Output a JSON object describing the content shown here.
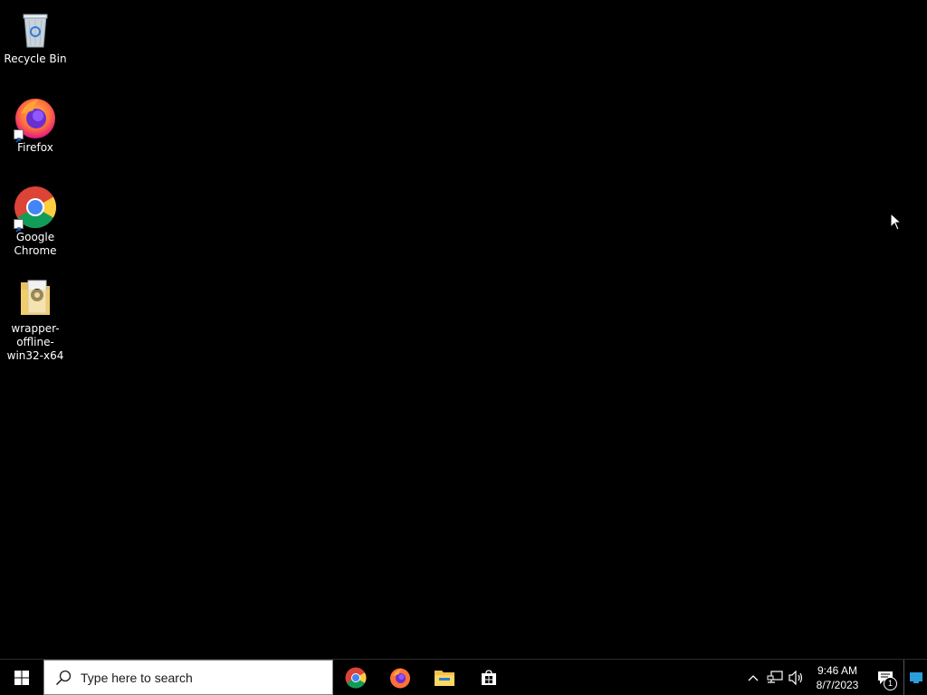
{
  "desktop": {
    "icons": [
      {
        "label": "Recycle Bin",
        "icon": "recycle-bin-icon"
      },
      {
        "label": "Firefox",
        "icon": "firefox-icon",
        "shortcut": true
      },
      {
        "label": "Google Chrome",
        "icon": "chrome-icon",
        "shortcut": true
      },
      {
        "label": "wrapper-offline-win32-x64",
        "icon": "folder-icon"
      }
    ],
    "background_color": "#000000"
  },
  "taskbar": {
    "start_icon": "windows-logo-icon",
    "search_placeholder": "Type here to search",
    "pinned": [
      {
        "name": "Google Chrome",
        "icon": "chrome-icon"
      },
      {
        "name": "Firefox",
        "icon": "firefox-icon"
      },
      {
        "name": "File Explorer",
        "icon": "file-explorer-icon"
      },
      {
        "name": "Microsoft Store",
        "icon": "store-icon"
      }
    ],
    "tray": {
      "time": "9:46 AM",
      "date": "8/7/2023",
      "notification_count": "1"
    }
  }
}
